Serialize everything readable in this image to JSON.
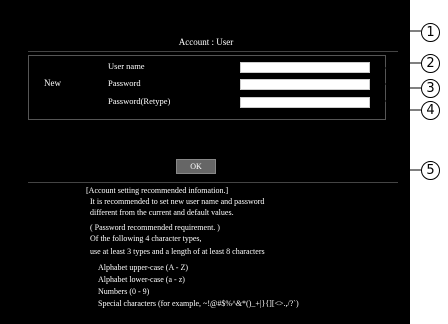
{
  "account_title": "Account : User",
  "form": {
    "section_label": "New",
    "fields": [
      {
        "label": "User name",
        "value": ""
      },
      {
        "label": "Password",
        "value": ""
      },
      {
        "label": "Password(Retype)",
        "value": ""
      }
    ],
    "ok_label": "OK"
  },
  "info": {
    "heading": "[Account setting recommended infomation.]",
    "line1": "It is recommended to set new user name and password",
    "line2": "different from the current and default values.",
    "req_heading": "( Password recommended requirement. )",
    "req_line1": "Of the following 4 character types,",
    "req_line2": "use at least 3 types and a length of at least 8 characters",
    "types": [
      "Alphabet upper-case (A - Z)",
      "Alphabet lower-case (a - z)",
      "Numbers (0 - 9)",
      "Special characters (for example, ~!@#$%^&*()_+|}{][<>.,/?`)"
    ]
  },
  "callouts": [
    "1",
    "2",
    "3",
    "4",
    "5"
  ]
}
